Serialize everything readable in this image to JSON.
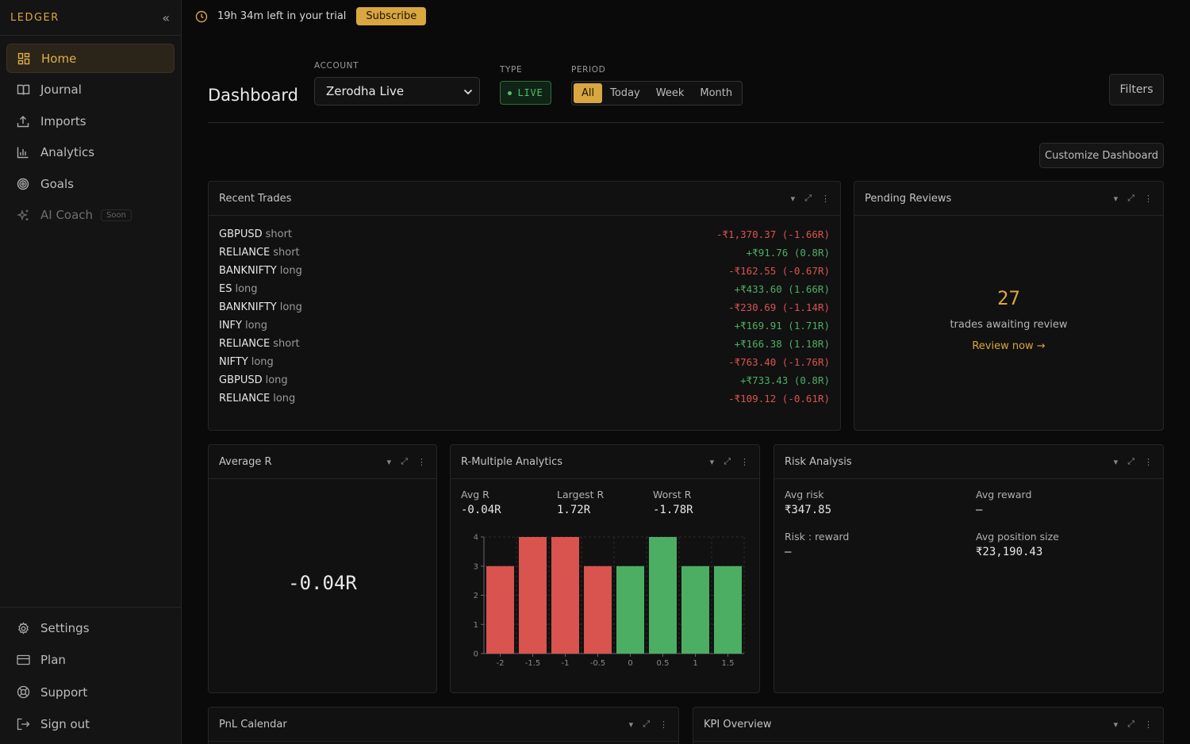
{
  "sidebar": {
    "brand": "LEDGER",
    "collapse_icon": "«",
    "items": [
      {
        "label": "Home",
        "icon": "grid-icon",
        "active": true
      },
      {
        "label": "Journal",
        "icon": "book-icon"
      },
      {
        "label": "Imports",
        "icon": "upload-icon"
      },
      {
        "label": "Analytics",
        "icon": "bar-chart-icon"
      },
      {
        "label": "Goals",
        "icon": "target-icon"
      },
      {
        "label": "AI Coach",
        "icon": "sparkle-icon",
        "badge": "Soon"
      }
    ],
    "bottom_items": [
      {
        "label": "Settings",
        "icon": "gear-icon"
      },
      {
        "label": "Plan",
        "icon": "card-icon"
      },
      {
        "label": "Support",
        "icon": "lifebuoy-icon"
      },
      {
        "label": "Sign out",
        "icon": "sign-out-icon"
      }
    ]
  },
  "topbar": {
    "trial_text": "19h 34m left in your trial",
    "subscribe_label": "Subscribe"
  },
  "header": {
    "title": "Dashboard",
    "account_label": "ACCOUNT",
    "account_value": "Zerodha Live",
    "type_label": "TYPE",
    "type_value": "LIVE",
    "period_label": "PERIOD",
    "periods": [
      "All",
      "Today",
      "Week",
      "Month"
    ],
    "selected_period": "All",
    "filters_label": "Filters",
    "customize_label": "Customize Dashboard"
  },
  "panel_tools": {
    "collapse": "▾",
    "expand": "⤢",
    "more": "⋮"
  },
  "recent_trades": {
    "title": "Recent Trades",
    "rows": [
      {
        "symbol": "GBPUSD",
        "dir": "short",
        "pnl": "-₹1,370.37 (-1.66R)",
        "positive": false
      },
      {
        "symbol": "RELIANCE",
        "dir": "short",
        "pnl": "+₹91.76 (0.8R)",
        "positive": true
      },
      {
        "symbol": "BANKNIFTY",
        "dir": "long",
        "pnl": "-₹162.55 (-0.67R)",
        "positive": false
      },
      {
        "symbol": "ES",
        "dir": "long",
        "pnl": "+₹433.60 (1.66R)",
        "positive": true
      },
      {
        "symbol": "BANKNIFTY",
        "dir": "long",
        "pnl": "-₹230.69 (-1.14R)",
        "positive": false
      },
      {
        "symbol": "INFY",
        "dir": "long",
        "pnl": "+₹169.91 (1.71R)",
        "positive": true
      },
      {
        "symbol": "RELIANCE",
        "dir": "short",
        "pnl": "+₹166.38 (1.18R)",
        "positive": true
      },
      {
        "symbol": "NIFTY",
        "dir": "long",
        "pnl": "-₹763.40 (-1.76R)",
        "positive": false
      },
      {
        "symbol": "GBPUSD",
        "dir": "long",
        "pnl": "+₹733.43 (0.8R)",
        "positive": true
      },
      {
        "symbol": "RELIANCE",
        "dir": "long",
        "pnl": "-₹109.12 (-0.61R)",
        "positive": false
      }
    ]
  },
  "pending_reviews": {
    "title": "Pending Reviews",
    "count": "27",
    "text": "trades awaiting review",
    "link": "Review now →"
  },
  "average_r": {
    "title": "Average R",
    "value": "-0.04R"
  },
  "r_multiple": {
    "title": "R-Multiple Analytics",
    "avg_label": "Avg R",
    "avg_value": "-0.04R",
    "largest_label": "Largest R",
    "largest_value": "1.72R",
    "worst_label": "Worst R",
    "worst_value": "-1.78R"
  },
  "chart_data": {
    "type": "bar",
    "categories": [
      "-2",
      "-1.5",
      "-1",
      "-0.5",
      "0",
      "0.5",
      "1",
      "1.5"
    ],
    "values": [
      3,
      4,
      4,
      3,
      3,
      4,
      3,
      3
    ],
    "bar_colors": [
      "#d9534f",
      "#d9534f",
      "#d9534f",
      "#d9534f",
      "#4cae63",
      "#4cae63",
      "#4cae63",
      "#4cae63"
    ],
    "ylim": [
      0,
      4
    ],
    "yticks": [
      "0",
      "1",
      "2",
      "3",
      "4"
    ],
    "grid": true
  },
  "risk_analysis": {
    "title": "Risk Analysis",
    "avg_risk_label": "Avg risk",
    "avg_risk_value": "₹347.85",
    "avg_reward_label": "Avg reward",
    "avg_reward_value": "—",
    "risk_reward_label": "Risk : reward",
    "risk_reward_value": "—",
    "avg_pos_label": "Avg position size",
    "avg_pos_value": "₹23,190.43"
  },
  "pnl_calendar": {
    "title": "PnL Calendar"
  },
  "kpi_overview": {
    "title": "KPI Overview"
  },
  "colors": {
    "accent": "#d9a640",
    "positive": "#4cae63",
    "negative": "#d9534f"
  }
}
